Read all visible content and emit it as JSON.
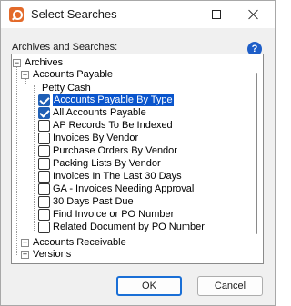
{
  "window": {
    "title": "Select Searches"
  },
  "dialog": {
    "section_label": "Archives and Searches:",
    "help_symbol": "?"
  },
  "tree": {
    "root": {
      "label": "Archives",
      "expander": "−"
    },
    "accounts_payable": {
      "label": "Accounts Payable",
      "expander": "−",
      "petty_cash": "Petty Cash",
      "searches": [
        {
          "label": "Accounts Payable By Type",
          "checked": true
        },
        {
          "label": "All Accounts Payable",
          "checked": true
        },
        {
          "label": "AP Records To Be Indexed",
          "checked": false
        },
        {
          "label": "Invoices By Vendor",
          "checked": false
        },
        {
          "label": "Purchase Orders By Vendor",
          "checked": false
        },
        {
          "label": "Packing Lists By Vendor",
          "checked": false
        },
        {
          "label": "Invoices In The Last 30 Days",
          "checked": false
        },
        {
          "label": "GA - Invoices Needing Approval",
          "checked": false
        },
        {
          "label": "30 Days Past Due",
          "checked": false
        },
        {
          "label": "Find Invoice or PO Number",
          "checked": false
        },
        {
          "label": "Related Document by PO Number",
          "checked": false
        }
      ]
    },
    "accounts_receivable": {
      "label": "Accounts Receivable",
      "expander": "+"
    },
    "versions": {
      "label": "Versions",
      "expander": "+"
    }
  },
  "buttons": {
    "ok": "OK",
    "cancel": "Cancel"
  },
  "colors": {
    "accent": "#1f5fb5",
    "selection": "#0a55cc",
    "ok_border": "#1a6fd6"
  }
}
